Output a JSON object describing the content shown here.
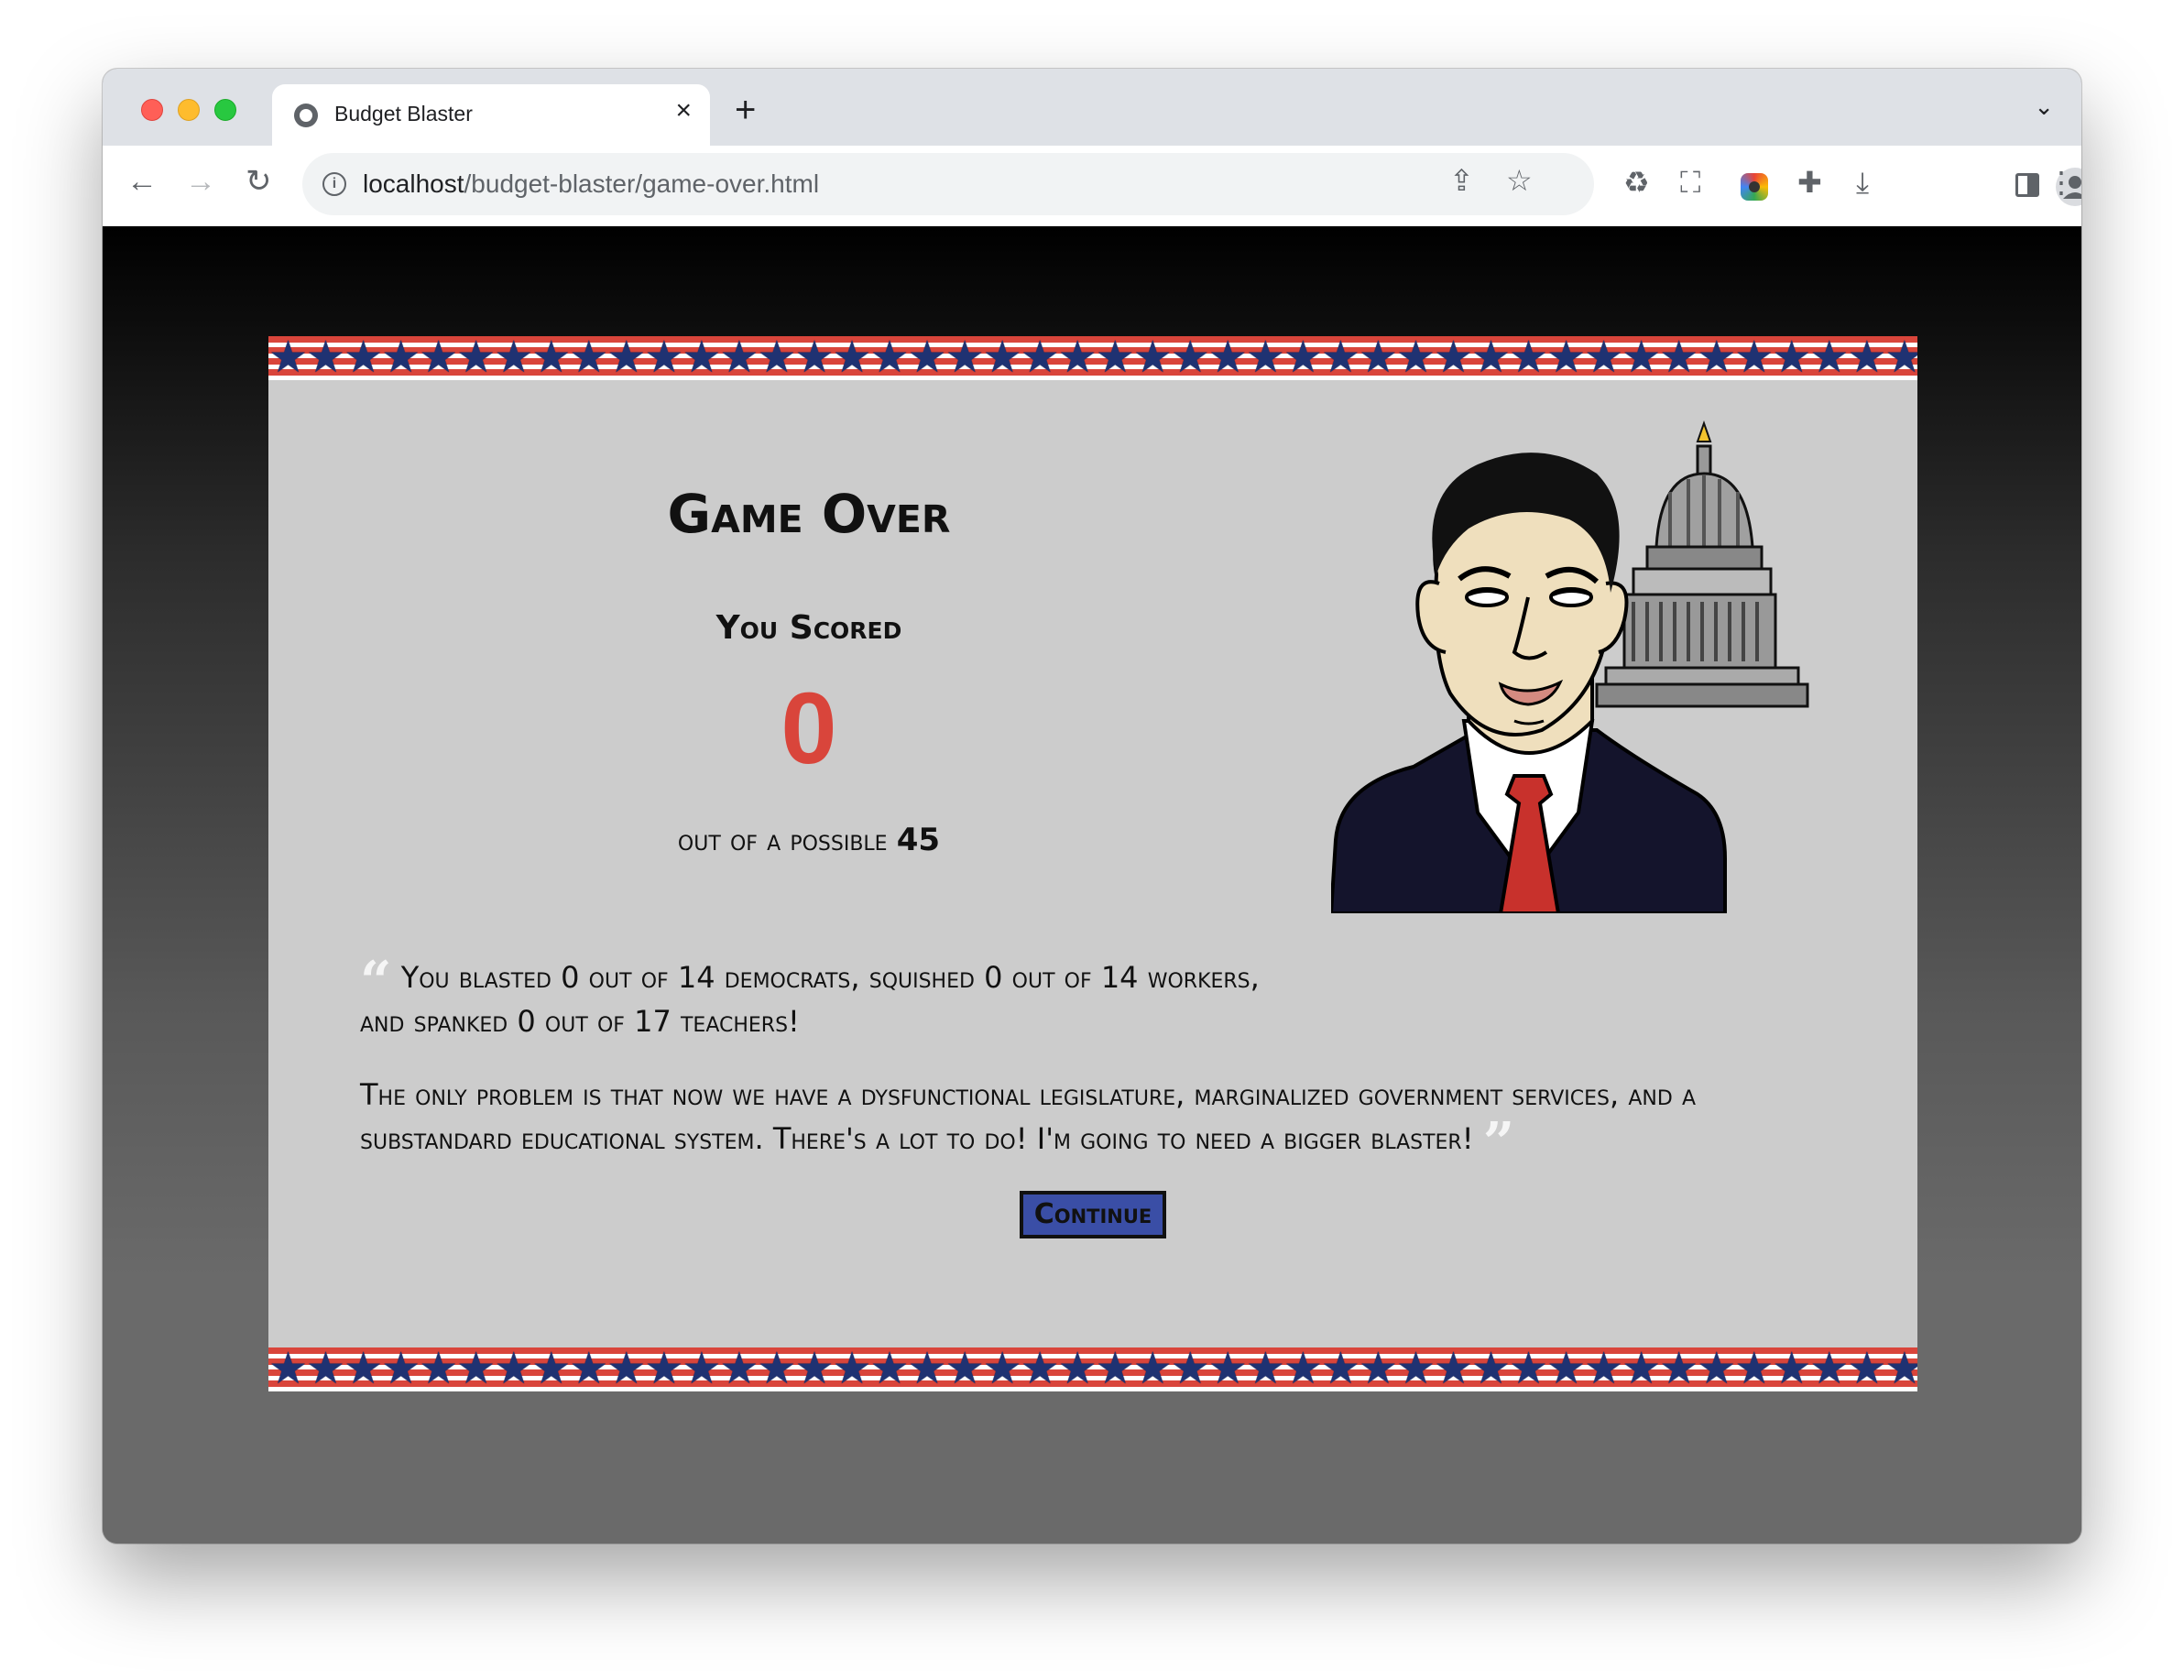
{
  "browser": {
    "tab_title": "Budget Blaster",
    "url_host": "localhost",
    "url_path": "/budget-blaster/game-over.html"
  },
  "game": {
    "title": "Game Over",
    "scored_label": "You Scored",
    "score": "0",
    "possible_prefix": "out of a possible",
    "possible_total": "45",
    "quote_line1": "You blasted 0 out of 14 democrats, squished 0 out of 14 workers, and spanked 0 out of 17 teachers!",
    "quote_line2": "The only problem is that now we have a dysfunctional legislature, marginalized government services, and a substandard educational system. There's a lot to do! I'm going to need a bigger blaster!",
    "continue_label": "Continue"
  },
  "colors": {
    "score_red": "#d9453b",
    "button_blue": "#3a4ea6",
    "panel_gray": "#cccccc",
    "star_blue": "#1f3272"
  },
  "icons": [
    "back-arrow-icon",
    "forward-arrow-icon",
    "reload-icon",
    "info-icon",
    "share-icon",
    "star-icon",
    "extension-icon",
    "screenshot-icon",
    "download-icon",
    "side-panel-icon",
    "profile-icon",
    "menu-icon"
  ]
}
